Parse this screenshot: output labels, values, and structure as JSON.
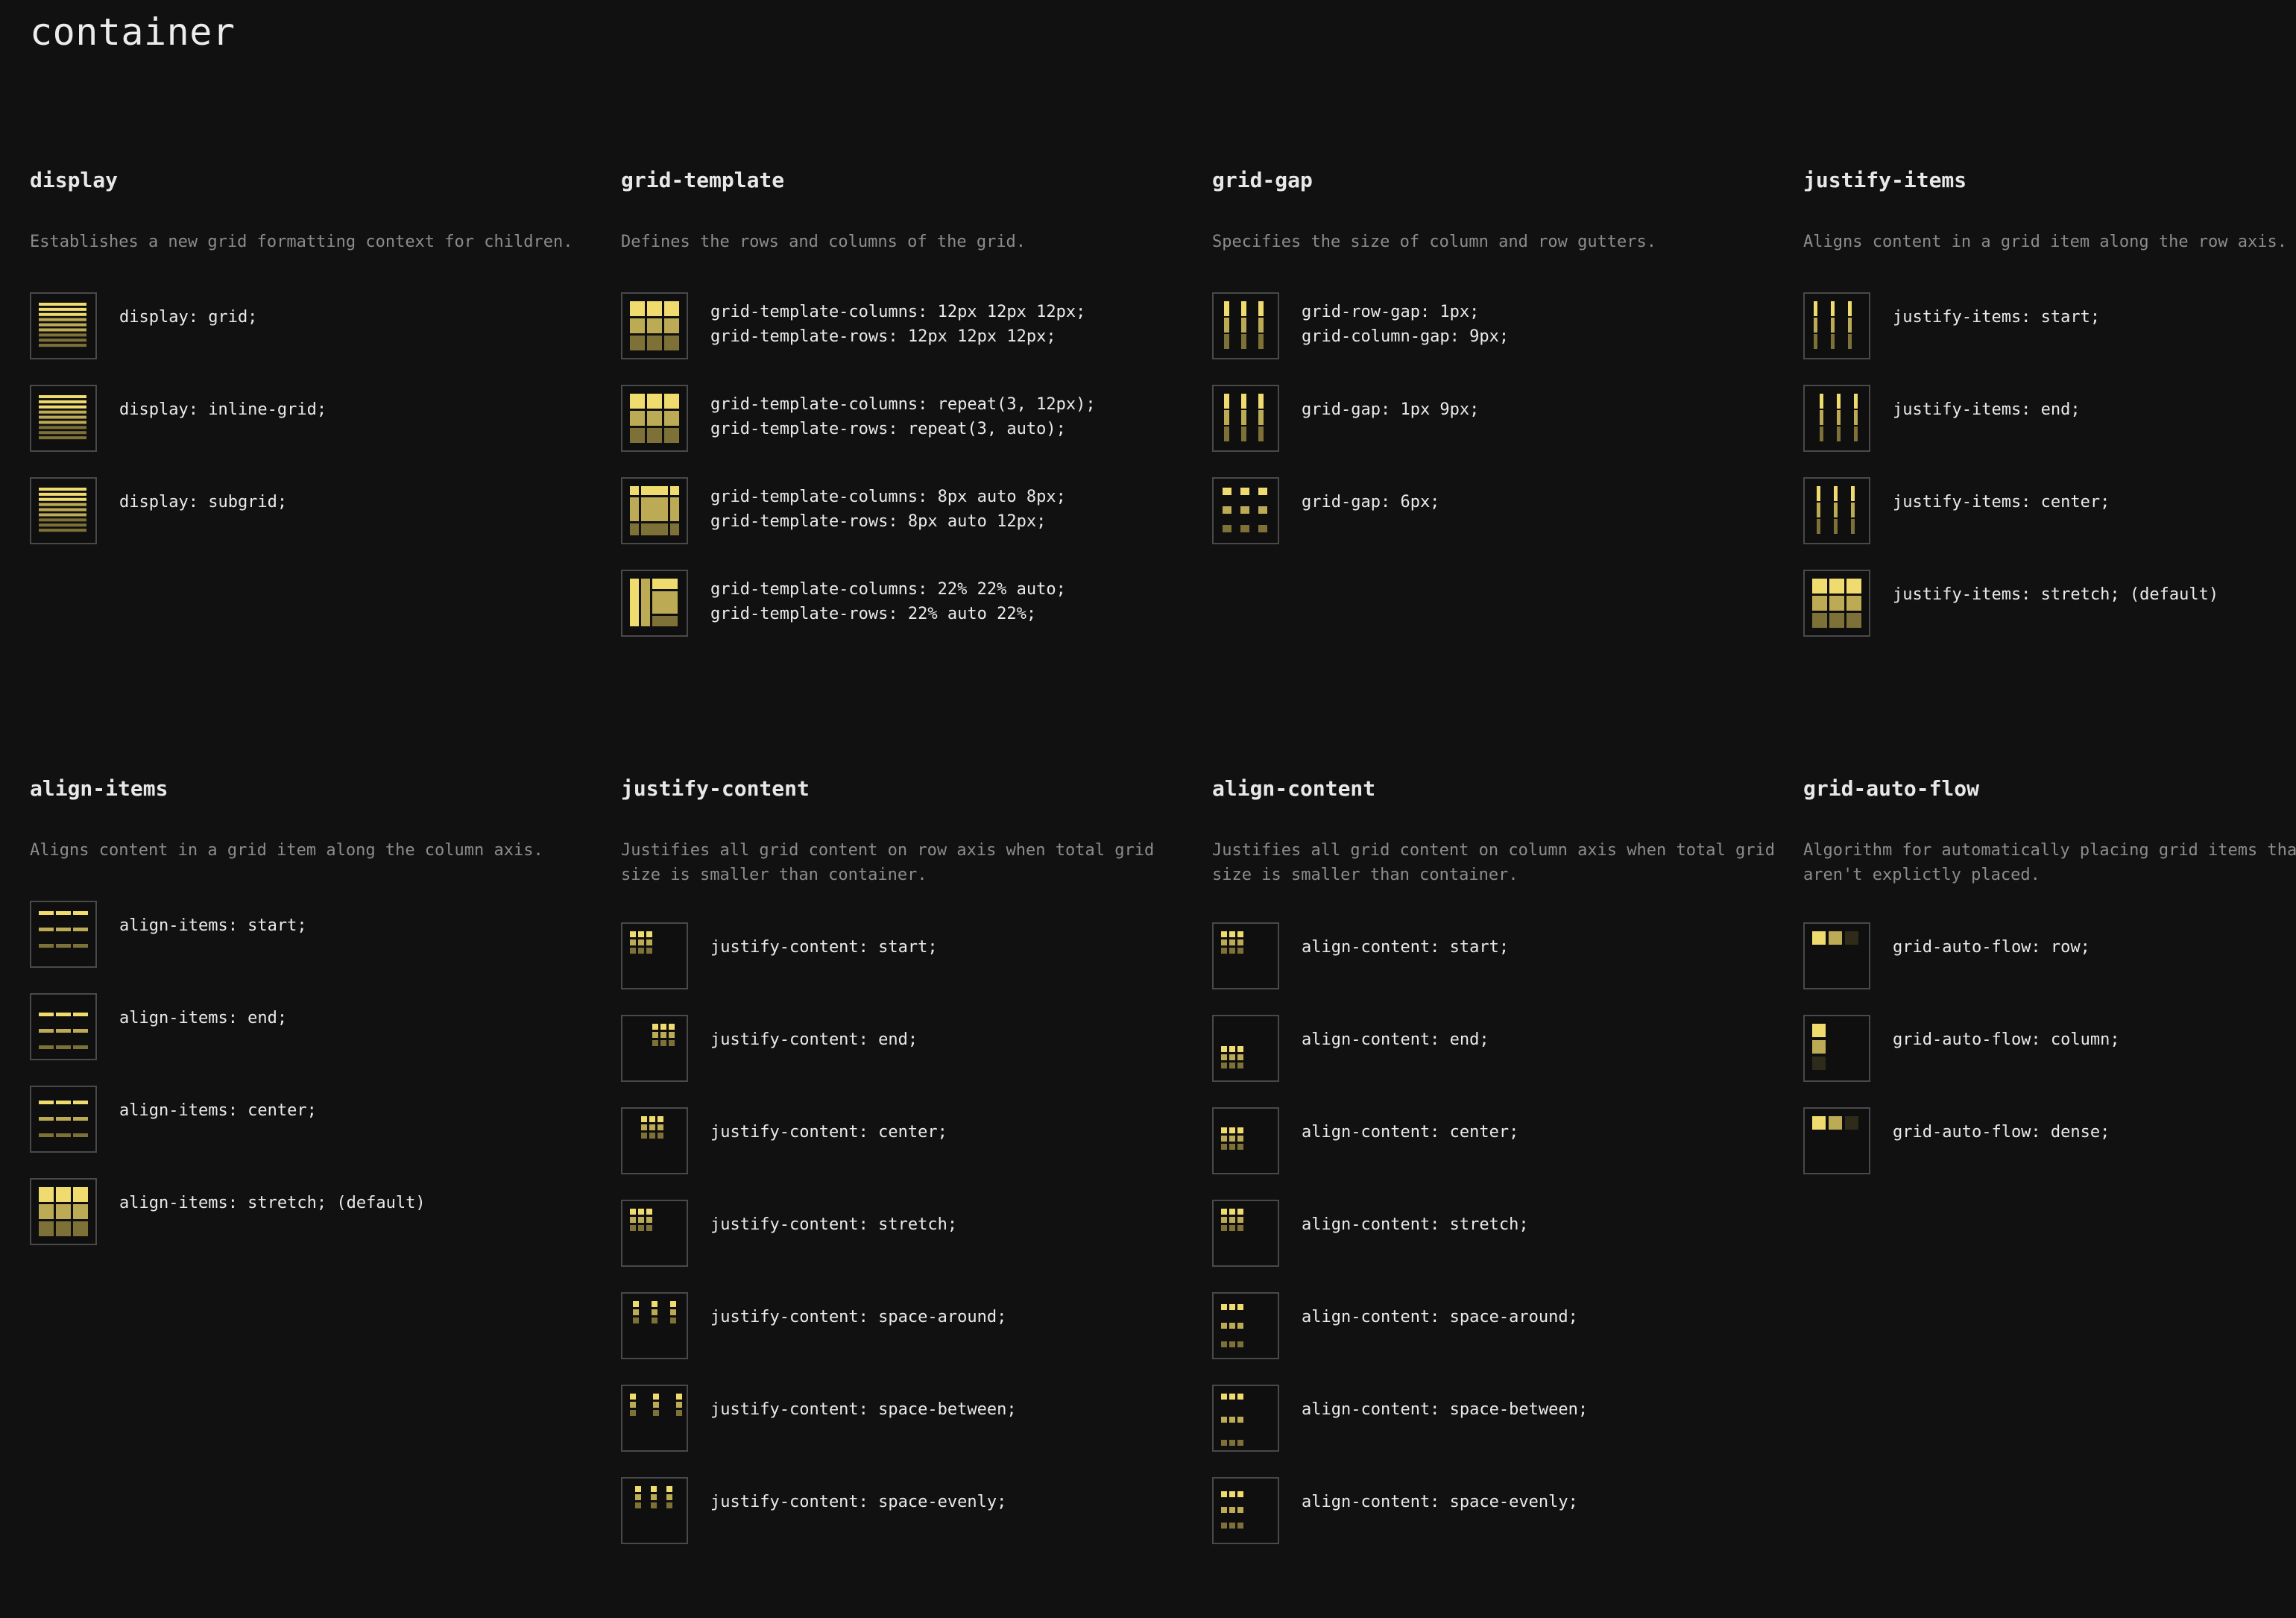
{
  "page": {
    "title": "container"
  },
  "colors": {
    "background": "#111111",
    "fill1": "#f0dc6e",
    "fill2": "#bcaa55",
    "fill3": "#7e7138",
    "ghost": "#2e2b1a",
    "frame": "#494949"
  },
  "sections": [
    {
      "title": "display",
      "desc": "Establishes a new grid formatting context for children.",
      "items": [
        {
          "lines": [
            "display: grid;"
          ],
          "icon": "display-grid-icon"
        },
        {
          "lines": [
            "display: inline-grid;"
          ],
          "icon": "display-inline-grid-icon"
        },
        {
          "lines": [
            "display: subgrid;"
          ],
          "icon": "display-subgrid-icon"
        }
      ]
    },
    {
      "title": "grid-template",
      "desc": "Defines the rows and columns of the grid.",
      "items": [
        {
          "lines": [
            "grid-template-columns: 12px 12px 12px;",
            "grid-template-rows: 12px 12px 12px;"
          ],
          "icon": "grid-template-fixed-icon"
        },
        {
          "lines": [
            "grid-template-columns: repeat(3, 12px);",
            "grid-template-rows: repeat(3, auto);"
          ],
          "icon": "grid-template-repeat-icon"
        },
        {
          "lines": [
            "grid-template-columns: 8px auto 8px;",
            "grid-template-rows: 8px auto 12px;"
          ],
          "icon": "grid-template-auto-icon"
        },
        {
          "lines": [
            "grid-template-columns: 22% 22% auto;",
            "grid-template-rows: 22% auto 22%;"
          ],
          "icon": "grid-template-percent-icon"
        }
      ]
    },
    {
      "title": "grid-gap",
      "desc": "Specifies the size of column and row gutters.",
      "items": [
        {
          "lines": [
            "grid-row-gap: 1px;",
            "grid-column-gap: 9px;"
          ],
          "icon": "grid-row-column-gap-icon"
        },
        {
          "lines": [
            "grid-gap: 1px 9px;"
          ],
          "icon": "grid-gap-1-9-icon"
        },
        {
          "lines": [
            "grid-gap: 6px;"
          ],
          "icon": "grid-gap-6-icon"
        }
      ]
    },
    {
      "title": "justify-items",
      "desc": "Aligns content in a grid item along the row axis.",
      "items": [
        {
          "lines": [
            "justify-items: start;"
          ],
          "icon": "justify-items-start-icon"
        },
        {
          "lines": [
            "justify-items: end;"
          ],
          "icon": "justify-items-end-icon"
        },
        {
          "lines": [
            "justify-items: center;"
          ],
          "icon": "justify-items-center-icon"
        },
        {
          "lines": [
            "justify-items: stretch; (default)"
          ],
          "icon": "justify-items-stretch-icon"
        }
      ]
    },
    {
      "title": "align-items",
      "desc": "Aligns content in a grid item along the column axis.",
      "items": [
        {
          "lines": [
            "align-items: start;"
          ],
          "icon": "align-items-start-icon"
        },
        {
          "lines": [
            "align-items: end;"
          ],
          "icon": "align-items-end-icon"
        },
        {
          "lines": [
            "align-items: center;"
          ],
          "icon": "align-items-center-icon"
        },
        {
          "lines": [
            "align-items: stretch; (default)"
          ],
          "icon": "align-items-stretch-icon"
        }
      ]
    },
    {
      "title": "justify-content",
      "desc": "Justifies all grid content on row axis when total grid size is smaller than container.",
      "items": [
        {
          "lines": [
            "justify-content: start;"
          ],
          "icon": "justify-content-start-icon"
        },
        {
          "lines": [
            "justify-content: end;"
          ],
          "icon": "justify-content-end-icon"
        },
        {
          "lines": [
            "justify-content: center;"
          ],
          "icon": "justify-content-center-icon"
        },
        {
          "lines": [
            "justify-content: stretch;"
          ],
          "icon": "justify-content-stretch-icon"
        },
        {
          "lines": [
            "justify-content: space-around;"
          ],
          "icon": "justify-content-space-around-icon"
        },
        {
          "lines": [
            "justify-content: space-between;"
          ],
          "icon": "justify-content-space-between-icon"
        },
        {
          "lines": [
            "justify-content: space-evenly;"
          ],
          "icon": "justify-content-space-evenly-icon"
        }
      ]
    },
    {
      "title": "align-content",
      "desc": "Justifies all grid content on column axis when total grid size is smaller than container.",
      "items": [
        {
          "lines": [
            "align-content: start;"
          ],
          "icon": "align-content-start-icon"
        },
        {
          "lines": [
            "align-content: end;"
          ],
          "icon": "align-content-end-icon"
        },
        {
          "lines": [
            "align-content: center;"
          ],
          "icon": "align-content-center-icon"
        },
        {
          "lines": [
            "align-content: stretch;"
          ],
          "icon": "align-content-stretch-icon"
        },
        {
          "lines": [
            "align-content: space-around;"
          ],
          "icon": "align-content-space-around-icon"
        },
        {
          "lines": [
            "align-content: space-between;"
          ],
          "icon": "align-content-space-between-icon"
        },
        {
          "lines": [
            "align-content: space-evenly;"
          ],
          "icon": "align-content-space-evenly-icon"
        }
      ]
    },
    {
      "title": "grid-auto-flow",
      "desc": "Algorithm for automatically placing grid items that aren't explictly placed.",
      "items": [
        {
          "lines": [
            "grid-auto-flow: row;"
          ],
          "icon": "grid-auto-flow-row-icon"
        },
        {
          "lines": [
            "grid-auto-flow: column;"
          ],
          "icon": "grid-auto-flow-column-icon"
        },
        {
          "lines": [
            "grid-auto-flow: dense;"
          ],
          "icon": "grid-auto-flow-dense-icon"
        }
      ]
    }
  ]
}
